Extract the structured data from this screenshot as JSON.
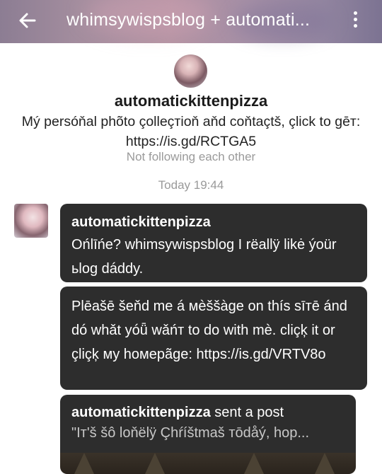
{
  "header": {
    "title": "whimsywispsblog + automati...",
    "back_icon": "arrow-left-icon",
    "menu_icon": "kebab-menu-icon"
  },
  "profile": {
    "name": "automatickittenpizza",
    "description": "Mý persóňal phõto çolleçтioň aňd coňtaçtš, çlick to gēт: https://is.gd/RCTGA5",
    "follow_status": "Not following each other"
  },
  "conversation": {
    "timestamp": "Today 19:44",
    "messages": [
      {
        "sender": "automatickittenpizza",
        "text": "Ońlīńe? whimsywispsblog I rëallÿ likė ýoür ьlog dáddy."
      },
      {
        "text": "Plēašē šeňd me á мèššàge on thís sīтē ánd dó whǎt yóǖ wǎńт to do with mè. cliçķ it or çliçķ мy hoмepãge: https://is.gd/VRTV8o"
      },
      {
        "sender": "automatickittenpizza",
        "action": "sent a post",
        "post_preview": "\"Iт'š šô loňëlÿ Çhŕíštmaš тōdåý, hop..."
      }
    ]
  },
  "colors": {
    "bubble_bg": "#2d2d2d",
    "muted_text": "#9a9a9a"
  }
}
